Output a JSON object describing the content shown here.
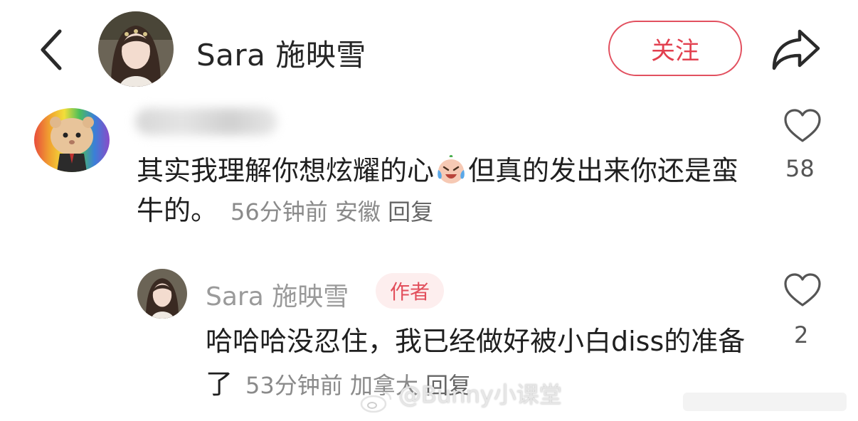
{
  "header": {
    "title": "Sara 施映雪",
    "follow_label": "关注",
    "icons": {
      "back": "chevron-left-icon",
      "share": "share-arrow-icon"
    }
  },
  "comment": {
    "text_before_emoji": "其实我理解你想炫耀的心",
    "emoji": "crying-laughing-emoji",
    "text_after_emoji": "但真的发出来你还是蛮牛的。",
    "time": "56分钟前",
    "location": "安徽",
    "reply_label": "回复",
    "likes": "58"
  },
  "reply": {
    "name": "Sara 施映雪",
    "badge": "作者",
    "text": "哈哈哈没忍住，我已经做好被小白diss的准备了",
    "time": "53分钟前",
    "location": "加拿大",
    "reply_label": "回复",
    "likes": "2"
  },
  "watermark": {
    "text": "@Bunny小课堂"
  },
  "colors": {
    "accent": "#e2404f",
    "badge_bg": "#fdeeee",
    "meta": "#8a8a8a"
  }
}
